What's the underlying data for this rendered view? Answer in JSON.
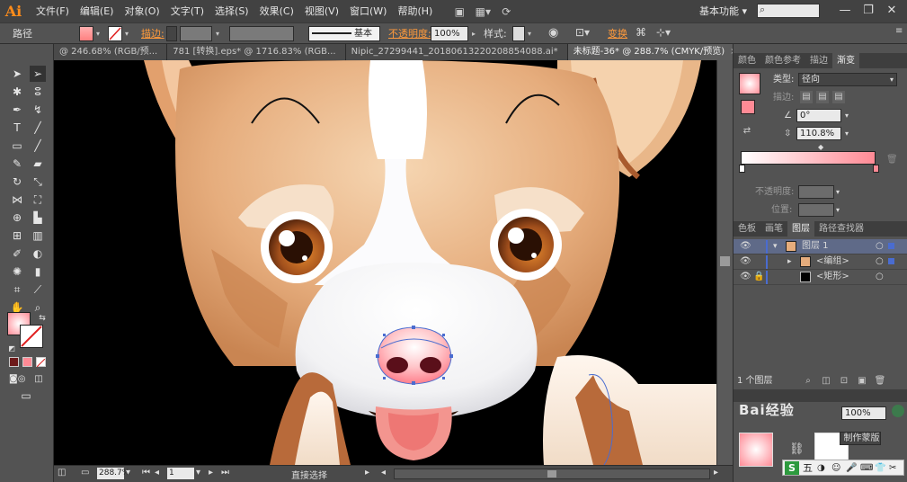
{
  "menubar": {
    "logo": "Ai",
    "items": [
      "文件(F)",
      "编辑(E)",
      "对象(O)",
      "文字(T)",
      "选择(S)",
      "效果(C)",
      "视图(V)",
      "窗口(W)",
      "帮助(H)"
    ],
    "workspace": "基本功能",
    "workspace_arrow": "▾",
    "search_icon": "search-icon",
    "window_controls": [
      "—",
      "❐",
      "✕"
    ]
  },
  "controlbar": {
    "object_type": "路径",
    "stroke_label": "描边:",
    "stroke_style": "基本",
    "opacity_label": "不透明度:",
    "opacity_value": "100%",
    "style_label": "样式:",
    "transform_link": "变换"
  },
  "doc_tabs": [
    {
      "label": "@ 246.68% (RGB/预...",
      "active": false
    },
    {
      "label": "781 [转换].eps* @ 1716.83% (RGB...",
      "active": false
    },
    {
      "label": "Nipic_27299441_20180613220208854088.ai*",
      "active": false
    },
    {
      "label": "未标题-36* @ 288.7% (CMYK/预览)",
      "active": true
    }
  ],
  "tab_close": "×",
  "statusbar": {
    "zoom": "288.7%",
    "page": "1",
    "tool": "直接选择"
  },
  "panels": {
    "top_tabs": [
      "颜色",
      "颜色参考",
      "描边",
      "渐变"
    ],
    "gradient": {
      "type_label": "类型:",
      "type_value": "径向",
      "stroke_label": "描边:",
      "angle_value": "0°",
      "ratio_value": "110.8%",
      "opacity_label": "不透明度:",
      "position_label": "位置:",
      "start_color": "#ffffff",
      "end_color": "#ff8a95"
    },
    "mid_tabs": [
      "色板",
      "画笔",
      "图层",
      "路径查找器"
    ],
    "layers": [
      {
        "name": "图层 1",
        "indent": 0,
        "expanded": true
      },
      {
        "name": "<编组>",
        "indent": 1,
        "expanded": false
      },
      {
        "name": "<矩形>",
        "indent": 1,
        "expanded": false
      }
    ],
    "layers_count": "1 个图层",
    "watermark": "Bai经验",
    "bottom_opacity": "100%",
    "make_mask": "制作蒙版",
    "ime_label": "五"
  },
  "colors": {
    "accent": "#ff9a3c",
    "selection_blue": "#4a6cd0",
    "dog_fur": "#e8b98f",
    "dog_dark_fur": "#b86a3a",
    "nose_pink": "#f4a0a8"
  }
}
